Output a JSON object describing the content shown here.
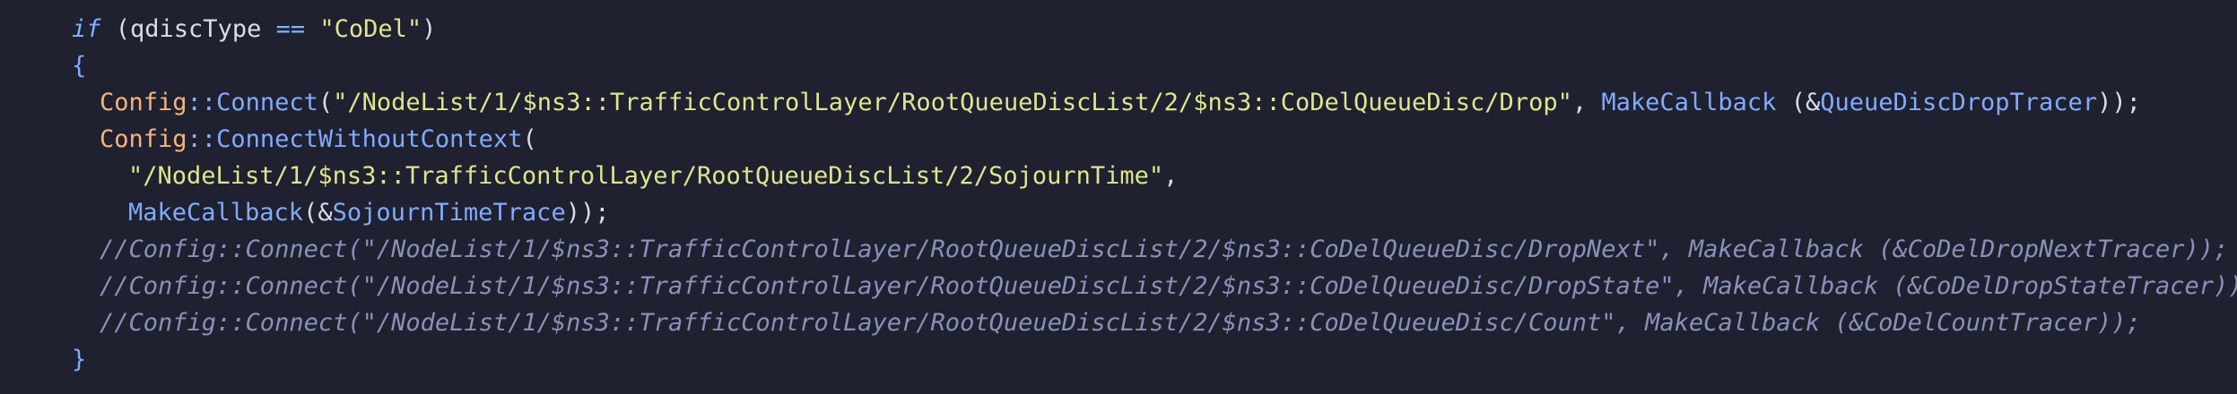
{
  "code": {
    "line1": {
      "kw": "if",
      "open": " (",
      "var": "qdiscType",
      "op": " == ",
      "str": "\"CoDel\"",
      "close": ")"
    },
    "line2": {
      "brace": "{"
    },
    "line3": {
      "cls": "Config",
      "scope": "::",
      "fn": "Connect",
      "open": "(",
      "str": "\"/NodeList/1/$ns3::TrafficControlLayer/RootQueueDiscList/2/$ns3::CoDelQueueDisc/Drop\"",
      "comma": ", ",
      "fn2": "MakeCallback",
      "open2": " (",
      "amp": "&",
      "tracer": "QueueDiscDropTracer",
      "close": "));"
    },
    "line4": {
      "cls": "Config",
      "scope": "::",
      "fn": "ConnectWithoutContext",
      "open": "("
    },
    "line5": {
      "str": "\"/NodeList/1/$ns3::TrafficControlLayer/RootQueueDiscList/2/SojournTime\"",
      "comma": ","
    },
    "line6": {
      "fn": "MakeCallback",
      "open": "(",
      "amp": "&",
      "tracer": "SojournTimeTrace",
      "close": "));"
    },
    "line7": {
      "comment": "//Config::Connect(\"/NodeList/1/$ns3::TrafficControlLayer/RootQueueDiscList/2/$ns3::CoDelQueueDisc/DropNext\", MakeCallback (&CoDelDropNextTracer));"
    },
    "line8": {
      "comment": "//Config::Connect(\"/NodeList/1/$ns3::TrafficControlLayer/RootQueueDiscList/2/$ns3::CoDelQueueDisc/DropState\", MakeCallback (&CoDelDropStateTracer));"
    },
    "line9": {
      "comment": "//Config::Connect(\"/NodeList/1/$ns3::TrafficControlLayer/RootQueueDiscList/2/$ns3::CoDelQueueDisc/Count\", MakeCallback (&CoDelCountTracer));"
    },
    "line10": {
      "brace": "}"
    }
  },
  "colors": {
    "background": "#1f2130",
    "keyword": "#7fb5ff",
    "string": "#dfe58f",
    "class": "#f6b37a",
    "function": "#82aaff",
    "comment": "#8a91b8",
    "text": "#d6deeb"
  }
}
